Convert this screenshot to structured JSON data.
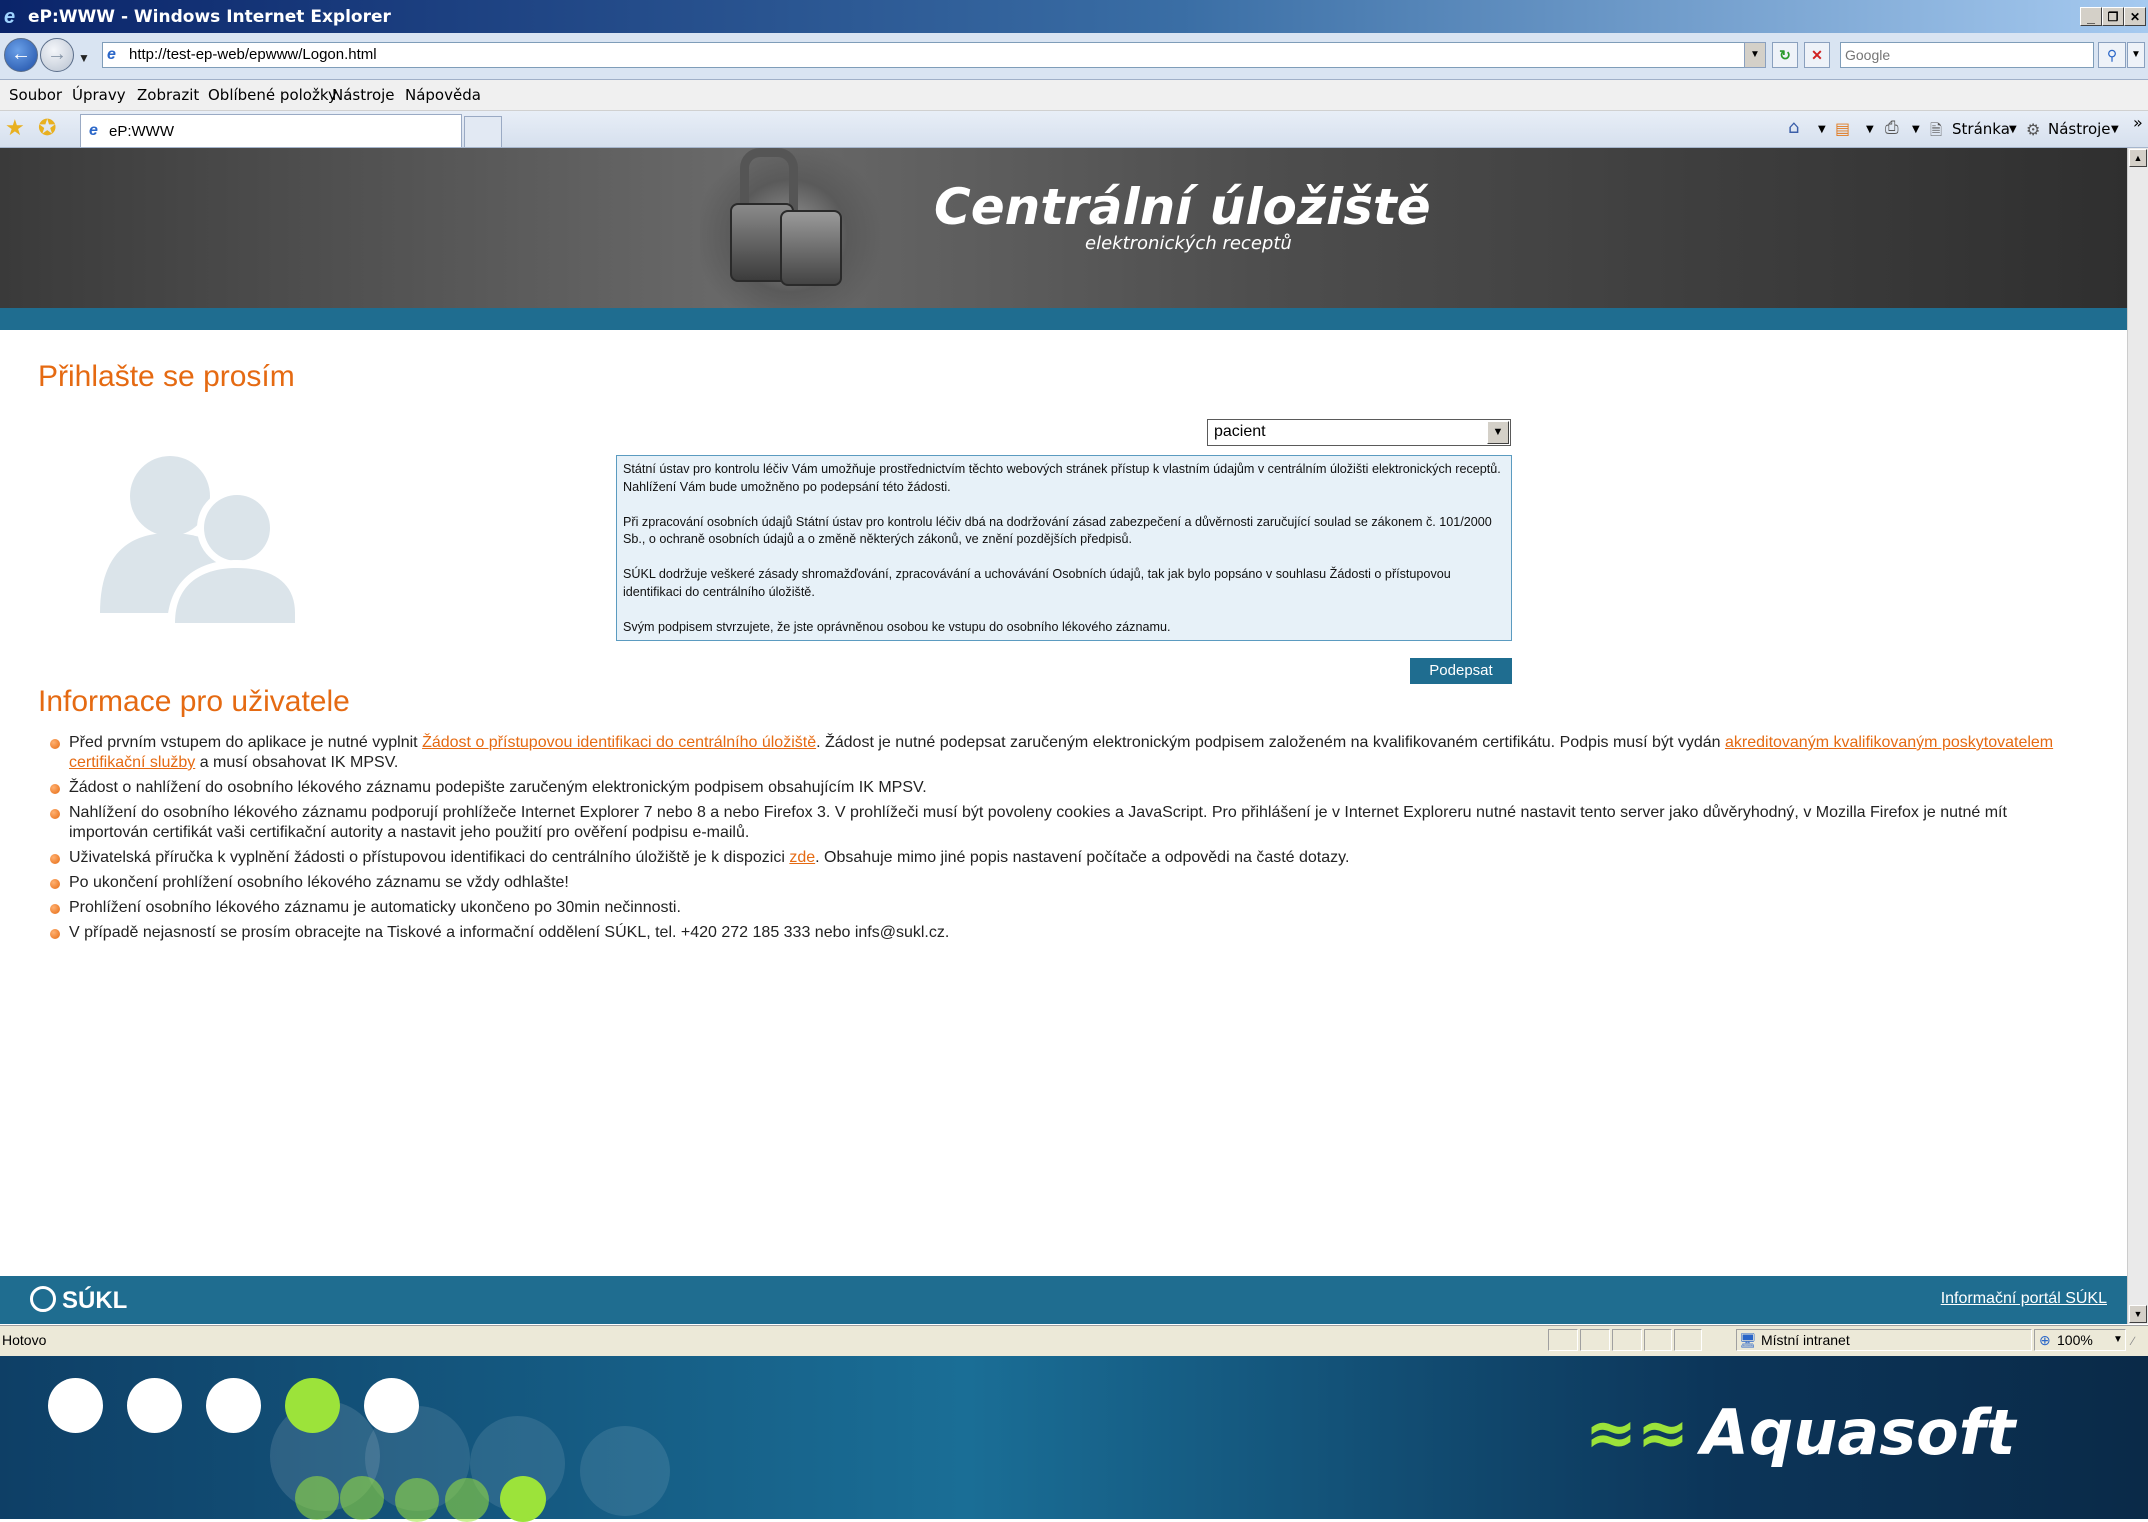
{
  "window": {
    "title": "eP:WWW - Windows Internet Explorer",
    "min": "_",
    "max": "❐",
    "close": "✕"
  },
  "address": {
    "url": "http://test-ep-web/epwww/Logon.html",
    "search_placeholder": "Google"
  },
  "menu": [
    "Soubor",
    "Úpravy",
    "Zobrazit",
    "Oblíbené položky",
    "Nástroje",
    "Nápověda"
  ],
  "tabs": {
    "active_label": "eP:WWW",
    "page_label": "Stránka",
    "tools_label": "Nástroje",
    "more": "»"
  },
  "banner": {
    "title": "Centrální úložiště",
    "subtitle": "elektronických receptů"
  },
  "login": {
    "heading": "Přihlašte se prosím",
    "role_value": "pacient",
    "info_paragraphs": [
      "Státní ústav pro kontrolu léčiv Vám umožňuje prostřednictvím těchto webových stránek přístup k vlastním údajům v centrálním úložišti elektronických receptů. Nahlížení Vám bude umožněno po podepsání této žádosti.",
      "Při zpracování osobních údajů Státní ústav pro kontrolu léčiv dbá na dodržování zásad zabezpečení a důvěrnosti zaručující soulad se zákonem č. 101/2000 Sb., o ochraně osobních údajů a o změně některých zákonů, ve znění pozdějších předpisů.",
      "SÚKL dodržuje veškeré zásady shromažďování, zpracovávání a uchovávání Osobních údajů, tak jak bylo popsáno v souhlasu Žádosti o přístupovou identifikaci do centrálního úložiště.",
      "Svým podpisem stvrzujete, že jste oprávněnou osobou ke vstupu do osobního lékového záznamu."
    ],
    "sign_button": "Podepsat"
  },
  "info": {
    "heading": "Informace pro uživatele",
    "item1": {
      "pre": "Před prvním vstupem do aplikace je nutné vyplnit ",
      "link1": "Žádost o přístupovou identifikaci do centrálního úložiště",
      "mid": ". Žádost je nutné podepsat zaručeným elektronickým podpisem založeném na kvalifikovaném certifikátu. Podpis musí být vydán ",
      "link2": "akreditovaným kvalifikovaným poskytovatelem certifikační služby",
      "post": " a musí obsahovat IK MPSV."
    },
    "item2": "Žádost o nahlížení do osobního lékového záznamu podepište zaručeným elektronickým podpisem obsahujícím IK MPSV.",
    "item3": "Nahlížení do osobního lékového záznamu podporují prohlížeče Internet Explorer 7 nebo 8 a nebo Firefox 3. V prohlížeči musí být povoleny cookies a JavaScript. Pro přihlášení je v Internet Exploreru nutné nastavit tento server jako důvěryhodný, v Mozilla Firefox je nutné mít importován certifikát vaši certifikační autority a nastavit jeho použití pro ověření podpisu e-mailů.",
    "item4": {
      "pre": "Uživatelská příručka k vyplnění žádosti o přístupovou identifikaci do centrálního úložiště je k dispozici ",
      "link": "zde",
      "post": ". Obsahuje mimo jiné popis nastavení počítače a odpovědi na časté dotazy."
    },
    "item5": "Po ukončení prohlížení osobního lékového záznamu se vždy odhlašte!",
    "item6": "Prohlížení osobního lékového záznamu je automaticky ukončeno po 30min nečinnosti.",
    "item7": "V případě nejasností se prosím obracejte na Tiskové a informační oddělení SÚKL, tel. +420 272 185 333 nebo infs@sukl.cz."
  },
  "footer": {
    "logo": "SÚKL",
    "link": "Informační portál SÚKL"
  },
  "status": {
    "text": "Hotovo",
    "zone": "Místní intranet",
    "zoom": "100%"
  },
  "brand": {
    "name": "Aquasoft"
  },
  "colors": {
    "accent_orange": "#e56a12",
    "brand_blue": "#1f6d90",
    "aquasoft_green": "#9ce33a"
  }
}
